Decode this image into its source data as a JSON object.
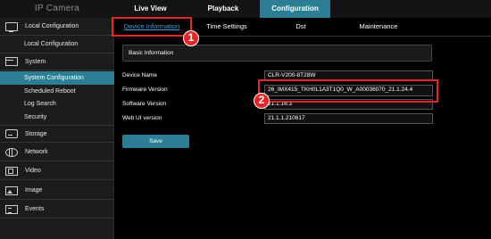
{
  "app": {
    "title": "IP Camera"
  },
  "topnav": {
    "tabs": [
      {
        "label": "Live View"
      },
      {
        "label": "Playback"
      },
      {
        "label": "Configuration",
        "active": true
      }
    ]
  },
  "sidebar": {
    "sections": [
      {
        "label": "Local Configuration",
        "icon": "monitor-icon",
        "children": [
          {
            "label": "Local Configuration"
          }
        ]
      },
      {
        "label": "System",
        "icon": "system-icon",
        "children": [
          {
            "label": "System Configuration",
            "active": true
          },
          {
            "label": "Scheduled Reboot"
          },
          {
            "label": "Log Search"
          },
          {
            "label": "Security"
          }
        ]
      },
      {
        "label": "Storage",
        "icon": "storage-icon"
      },
      {
        "label": "Network",
        "icon": "globe-icon"
      },
      {
        "label": "Video",
        "icon": "video-icon"
      },
      {
        "label": "Image",
        "icon": "image-icon"
      },
      {
        "label": "Events",
        "icon": "events-icon"
      }
    ]
  },
  "subtabs": [
    {
      "label": "Device Information",
      "active": true
    },
    {
      "label": "Time Settings"
    },
    {
      "label": "Dst"
    },
    {
      "label": "Maintenance"
    }
  ],
  "content": {
    "section_title": "Basic Information",
    "fields": [
      {
        "label": "Device Name",
        "value": "CLR-V200-8T28W"
      },
      {
        "label": "Firmware Version",
        "value": "26_IMX415_TKH0L1A3T1Q0_W_A00036070_21.1.24.4"
      },
      {
        "label": "Software Version",
        "value": "21.1.16.3"
      },
      {
        "label": "Web UI version",
        "value": "21.1.1.210617"
      }
    ],
    "save_label": "Save"
  },
  "annotations": [
    {
      "number": "1"
    },
    {
      "number": "2"
    }
  ],
  "colors": {
    "accent": "#2b7e93",
    "annotation": "#e32626",
    "active_link": "#4a9fd8"
  }
}
